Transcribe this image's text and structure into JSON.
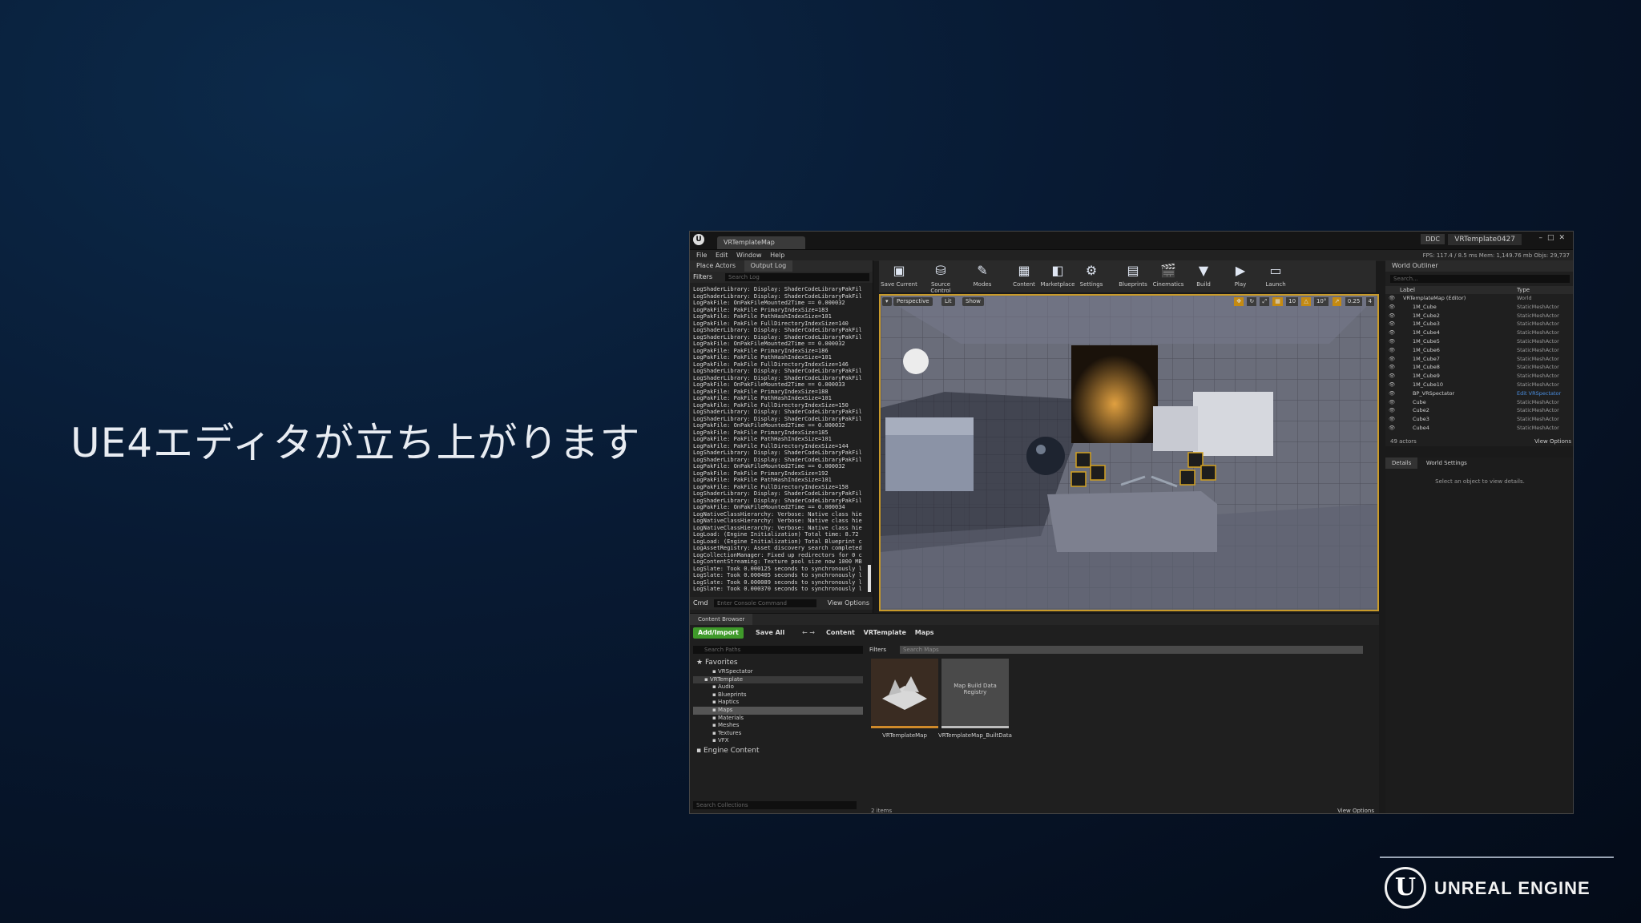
{
  "slide": {
    "title": "UE4エディタが立ち上がります",
    "brand": "UNREAL ENGINE"
  },
  "window": {
    "map_tab": "VRTemplateMap",
    "project": "VRTemplate0427",
    "ddc": "DDC",
    "menu": [
      "File",
      "Edit",
      "Window",
      "Help"
    ],
    "stats": "FPS: 117.4 / 8.5 ms  Mem: 1,149.76 mb  Objs: 29,737"
  },
  "left_panel": {
    "tabs": [
      "Place Actors",
      "Output Log"
    ],
    "filters": "Filters",
    "search_placeholder": "Search Log",
    "log_lines": [
      "LogShaderLibrary: Display: ShaderCodeLibraryPakFil",
      "LogShaderLibrary: Display: ShaderCodeLibraryPakFil",
      "LogPakFile: OnPakFileMounted2Time == 0.000032",
      "LogPakFile: PakFile PrimaryIndexSize=183",
      "LogPakFile: PakFile PathHashIndexSize=101",
      "LogPakFile: PakFile FullDirectoryIndexSize=140",
      "LogShaderLibrary: Display: ShaderCodeLibraryPakFil",
      "LogShaderLibrary: Display: ShaderCodeLibraryPakFil",
      "LogPakFile: OnPakFileMounted2Time == 0.000032",
      "LogPakFile: PakFile PrimaryIndexSize=186",
      "LogPakFile: PakFile PathHashIndexSize=101",
      "LogPakFile: PakFile FullDirectoryIndexSize=146",
      "LogShaderLibrary: Display: ShaderCodeLibraryPakFil",
      "LogShaderLibrary: Display: ShaderCodeLibraryPakFil",
      "LogPakFile: OnPakFileMounted2Time == 0.000033",
      "LogPakFile: PakFile PrimaryIndexSize=188",
      "LogPakFile: PakFile PathHashIndexSize=101",
      "LogPakFile: PakFile FullDirectoryIndexSize=150",
      "LogShaderLibrary: Display: ShaderCodeLibraryPakFil",
      "LogShaderLibrary: Display: ShaderCodeLibraryPakFil",
      "LogPakFile: OnPakFileMounted2Time == 0.000032",
      "LogPakFile: PakFile PrimaryIndexSize=185",
      "LogPakFile: PakFile PathHashIndexSize=101",
      "LogPakFile: PakFile FullDirectoryIndexSize=144",
      "LogShaderLibrary: Display: ShaderCodeLibraryPakFil",
      "LogShaderLibrary: Display: ShaderCodeLibraryPakFil",
      "LogPakFile: OnPakFileMounted2Time == 0.000032",
      "LogPakFile: PakFile PrimaryIndexSize=192",
      "LogPakFile: PakFile PathHashIndexSize=101",
      "LogPakFile: PakFile FullDirectoryIndexSize=158",
      "LogShaderLibrary: Display: ShaderCodeLibraryPakFil",
      "LogShaderLibrary: Display: ShaderCodeLibraryPakFil",
      "LogPakFile: OnPakFileMounted2Time == 0.000034",
      "LogNativeClassHierarchy: Verbose: Native class hie",
      "LogNativeClassHierarchy: Verbose: Native class hie",
      "LogNativeClassHierarchy: Verbose: Native class hie",
      "LogLoad: (Engine Initialization) Total time: 8.72",
      "LogLoad: (Engine Initialization) Total Blueprint c",
      "LogAssetRegistry: Asset discovery search completed",
      "LogCollectionManager: Fixed up redirectors for 0 c",
      "LogContentStreaming: Texture pool size now 1000 MB",
      "LogSlate: Took 0.000125 seconds to synchronously l",
      "LogSlate: Took 0.000405 seconds to synchronously l",
      "LogSlate: Took 0.000089 seconds to synchronously l",
      "LogSlate: Took 0.000370 seconds to synchronously l"
    ],
    "cmd": "Cmd",
    "console_placeholder": "Enter Console Command",
    "view_options": "View Options"
  },
  "toolbar": {
    "buttons": [
      {
        "label": "Save Current",
        "icon": "save-icon",
        "glyph": "▣"
      },
      {
        "label": "Source Control",
        "icon": "source-control-icon",
        "glyph": "⛁"
      },
      {
        "label": "Modes",
        "icon": "modes-icon",
        "glyph": "✎"
      },
      {
        "label": "Content",
        "icon": "content-icon",
        "glyph": "▦"
      },
      {
        "label": "Marketplace",
        "icon": "marketplace-icon",
        "glyph": "◧"
      },
      {
        "label": "Settings",
        "icon": "settings-icon",
        "glyph": "⚙"
      },
      {
        "label": "Blueprints",
        "icon": "blueprints-icon",
        "glyph": "▤"
      },
      {
        "label": "Cinematics",
        "icon": "cinematics-icon",
        "glyph": "🎬"
      },
      {
        "label": "Build",
        "icon": "build-icon",
        "glyph": "▼"
      },
      {
        "label": "Play",
        "icon": "play-icon",
        "glyph": "▶"
      },
      {
        "label": "Launch",
        "icon": "launch-icon",
        "glyph": "▭"
      }
    ]
  },
  "viewport": {
    "perspective": "Perspective",
    "lit": "Lit",
    "show": "Show",
    "grid_snap": "10",
    "rot_snap": "10°",
    "scale_snap": "0.25",
    "cam_speed": "4"
  },
  "outliner": {
    "title": "World Outliner",
    "search_placeholder": "Search...",
    "col_label": "Label",
    "col_type": "Type",
    "rows": [
      {
        "name": "VRTemplateMap (Editor)",
        "type": "World"
      },
      {
        "name": "1M_Cube",
        "type": "StaticMeshActor"
      },
      {
        "name": "1M_Cube2",
        "type": "StaticMeshActor"
      },
      {
        "name": "1M_Cube3",
        "type": "StaticMeshActor"
      },
      {
        "name": "1M_Cube4",
        "type": "StaticMeshActor"
      },
      {
        "name": "1M_Cube5",
        "type": "StaticMeshActor"
      },
      {
        "name": "1M_Cube6",
        "type": "StaticMeshActor"
      },
      {
        "name": "1M_Cube7",
        "type": "StaticMeshActor"
      },
      {
        "name": "1M_Cube8",
        "type": "StaticMeshActor"
      },
      {
        "name": "1M_Cube9",
        "type": "StaticMeshActor"
      },
      {
        "name": "1M_Cube10",
        "type": "StaticMeshActor"
      },
      {
        "name": "BP_VRSpectator",
        "type": "Edit VRSpectator"
      },
      {
        "name": "Cube",
        "type": "StaticMeshActor"
      },
      {
        "name": "Cube2",
        "type": "StaticMeshActor"
      },
      {
        "name": "Cube3",
        "type": "StaticMeshActor"
      },
      {
        "name": "Cube4",
        "type": "StaticMeshActor"
      }
    ],
    "actors": "49 actors",
    "view_options": "View Options"
  },
  "details": {
    "tabs": [
      "Details",
      "World Settings"
    ],
    "message": "Select an object to view details."
  },
  "content_browser": {
    "tab": "Content Browser",
    "add_import": "Add/Import",
    "save_all": "Save All",
    "breadcrumb": [
      "Content",
      "VRTemplate",
      "Maps"
    ],
    "path_search": "Search Paths",
    "tree": [
      {
        "label": "Favorites",
        "kind": "big",
        "indent": 0
      },
      {
        "label": "VRSpectator",
        "kind": "node",
        "indent": 2
      },
      {
        "label": "VRTemplate",
        "kind": "hl",
        "indent": 1
      },
      {
        "label": "Audio",
        "kind": "node",
        "indent": 2
      },
      {
        "label": "Blueprints",
        "kind": "node",
        "indent": 2
      },
      {
        "label": "Haptics",
        "kind": "node",
        "indent": 2
      },
      {
        "label": "Maps",
        "kind": "sel",
        "indent": 2
      },
      {
        "label": "Materials",
        "kind": "node",
        "indent": 2
      },
      {
        "label": "Meshes",
        "kind": "node",
        "indent": 2
      },
      {
        "label": "Textures",
        "kind": "node",
        "indent": 2
      },
      {
        "label": "VFX",
        "kind": "node",
        "indent": 2
      },
      {
        "label": "Engine Content",
        "kind": "big",
        "indent": 0
      }
    ],
    "collections_search": "Search Collections",
    "filters": "Filters",
    "asset_search": "Search Maps",
    "assets": [
      {
        "label": "VRTemplateMap",
        "thumb": "map"
      },
      {
        "label": "VRTemplateMap_BuiltData",
        "thumb": "Map Build Data Registry"
      }
    ],
    "items": "2 items",
    "view_options": "View Options"
  }
}
